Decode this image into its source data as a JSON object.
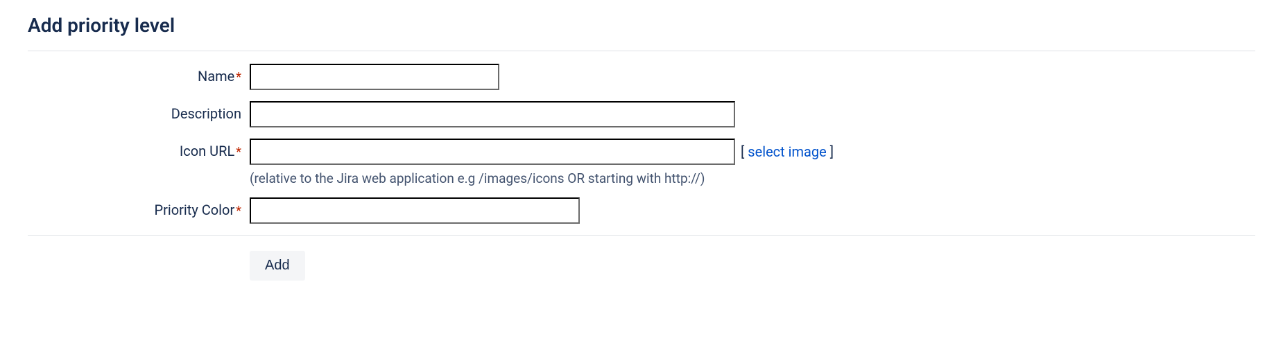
{
  "form": {
    "title": "Add priority level",
    "fields": {
      "name": {
        "label": "Name",
        "value": ""
      },
      "description": {
        "label": "Description",
        "value": ""
      },
      "iconUrl": {
        "label": "Icon URL",
        "value": "",
        "hint": "(relative to the Jira web application e.g /images/icons OR starting with http://)",
        "selectImageBracketOpen": "[",
        "selectImageText": "select image",
        "selectImageBracketClose": "]"
      },
      "priorityColor": {
        "label": "Priority Color",
        "value": ""
      }
    },
    "submitLabel": "Add"
  }
}
